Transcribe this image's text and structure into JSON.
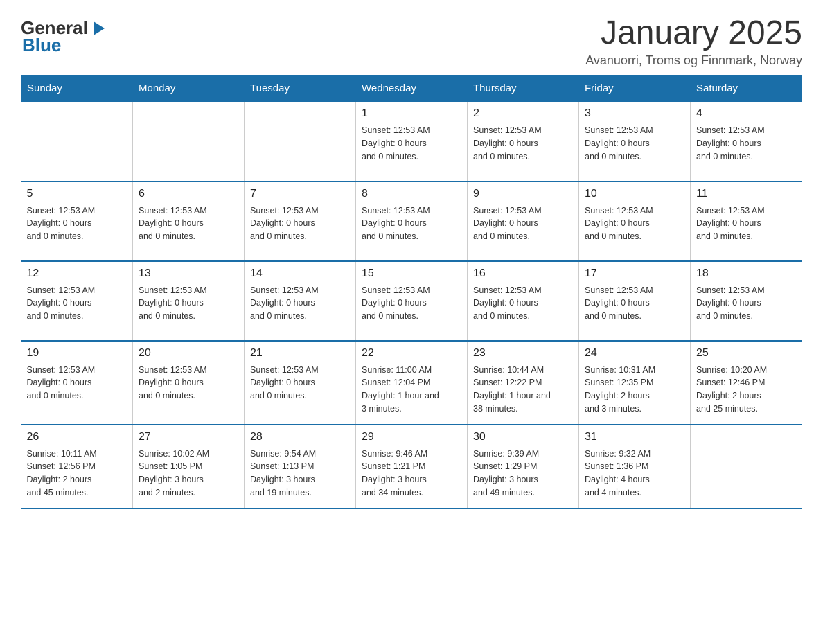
{
  "header": {
    "logo_general": "General",
    "logo_blue": "Blue",
    "month_title": "January 2025",
    "location": "Avanuorri, Troms og Finnmark, Norway"
  },
  "weekdays": [
    "Sunday",
    "Monday",
    "Tuesday",
    "Wednesday",
    "Thursday",
    "Friday",
    "Saturday"
  ],
  "weeks": [
    [
      {
        "day": "",
        "info": ""
      },
      {
        "day": "",
        "info": ""
      },
      {
        "day": "",
        "info": ""
      },
      {
        "day": "1",
        "info": "Sunset: 12:53 AM\nDaylight: 0 hours\nand 0 minutes."
      },
      {
        "day": "2",
        "info": "Sunset: 12:53 AM\nDaylight: 0 hours\nand 0 minutes."
      },
      {
        "day": "3",
        "info": "Sunset: 12:53 AM\nDaylight: 0 hours\nand 0 minutes."
      },
      {
        "day": "4",
        "info": "Sunset: 12:53 AM\nDaylight: 0 hours\nand 0 minutes."
      }
    ],
    [
      {
        "day": "5",
        "info": "Sunset: 12:53 AM\nDaylight: 0 hours\nand 0 minutes."
      },
      {
        "day": "6",
        "info": "Sunset: 12:53 AM\nDaylight: 0 hours\nand 0 minutes."
      },
      {
        "day": "7",
        "info": "Sunset: 12:53 AM\nDaylight: 0 hours\nand 0 minutes."
      },
      {
        "day": "8",
        "info": "Sunset: 12:53 AM\nDaylight: 0 hours\nand 0 minutes."
      },
      {
        "day": "9",
        "info": "Sunset: 12:53 AM\nDaylight: 0 hours\nand 0 minutes."
      },
      {
        "day": "10",
        "info": "Sunset: 12:53 AM\nDaylight: 0 hours\nand 0 minutes."
      },
      {
        "day": "11",
        "info": "Sunset: 12:53 AM\nDaylight: 0 hours\nand 0 minutes."
      }
    ],
    [
      {
        "day": "12",
        "info": "Sunset: 12:53 AM\nDaylight: 0 hours\nand 0 minutes."
      },
      {
        "day": "13",
        "info": "Sunset: 12:53 AM\nDaylight: 0 hours\nand 0 minutes."
      },
      {
        "day": "14",
        "info": "Sunset: 12:53 AM\nDaylight: 0 hours\nand 0 minutes."
      },
      {
        "day": "15",
        "info": "Sunset: 12:53 AM\nDaylight: 0 hours\nand 0 minutes."
      },
      {
        "day": "16",
        "info": "Sunset: 12:53 AM\nDaylight: 0 hours\nand 0 minutes."
      },
      {
        "day": "17",
        "info": "Sunset: 12:53 AM\nDaylight: 0 hours\nand 0 minutes."
      },
      {
        "day": "18",
        "info": "Sunset: 12:53 AM\nDaylight: 0 hours\nand 0 minutes."
      }
    ],
    [
      {
        "day": "19",
        "info": "Sunset: 12:53 AM\nDaylight: 0 hours\nand 0 minutes."
      },
      {
        "day": "20",
        "info": "Sunset: 12:53 AM\nDaylight: 0 hours\nand 0 minutes."
      },
      {
        "day": "21",
        "info": "Sunset: 12:53 AM\nDaylight: 0 hours\nand 0 minutes."
      },
      {
        "day": "22",
        "info": "Sunrise: 11:00 AM\nSunset: 12:04 PM\nDaylight: 1 hour and\n3 minutes."
      },
      {
        "day": "23",
        "info": "Sunrise: 10:44 AM\nSunset: 12:22 PM\nDaylight: 1 hour and\n38 minutes."
      },
      {
        "day": "24",
        "info": "Sunrise: 10:31 AM\nSunset: 12:35 PM\nDaylight: 2 hours\nand 3 minutes."
      },
      {
        "day": "25",
        "info": "Sunrise: 10:20 AM\nSunset: 12:46 PM\nDaylight: 2 hours\nand 25 minutes."
      }
    ],
    [
      {
        "day": "26",
        "info": "Sunrise: 10:11 AM\nSunset: 12:56 PM\nDaylight: 2 hours\nand 45 minutes."
      },
      {
        "day": "27",
        "info": "Sunrise: 10:02 AM\nSunset: 1:05 PM\nDaylight: 3 hours\nand 2 minutes."
      },
      {
        "day": "28",
        "info": "Sunrise: 9:54 AM\nSunset: 1:13 PM\nDaylight: 3 hours\nand 19 minutes."
      },
      {
        "day": "29",
        "info": "Sunrise: 9:46 AM\nSunset: 1:21 PM\nDaylight: 3 hours\nand 34 minutes."
      },
      {
        "day": "30",
        "info": "Sunrise: 9:39 AM\nSunset: 1:29 PM\nDaylight: 3 hours\nand 49 minutes."
      },
      {
        "day": "31",
        "info": "Sunrise: 9:32 AM\nSunset: 1:36 PM\nDaylight: 4 hours\nand 4 minutes."
      },
      {
        "day": "",
        "info": ""
      }
    ]
  ]
}
